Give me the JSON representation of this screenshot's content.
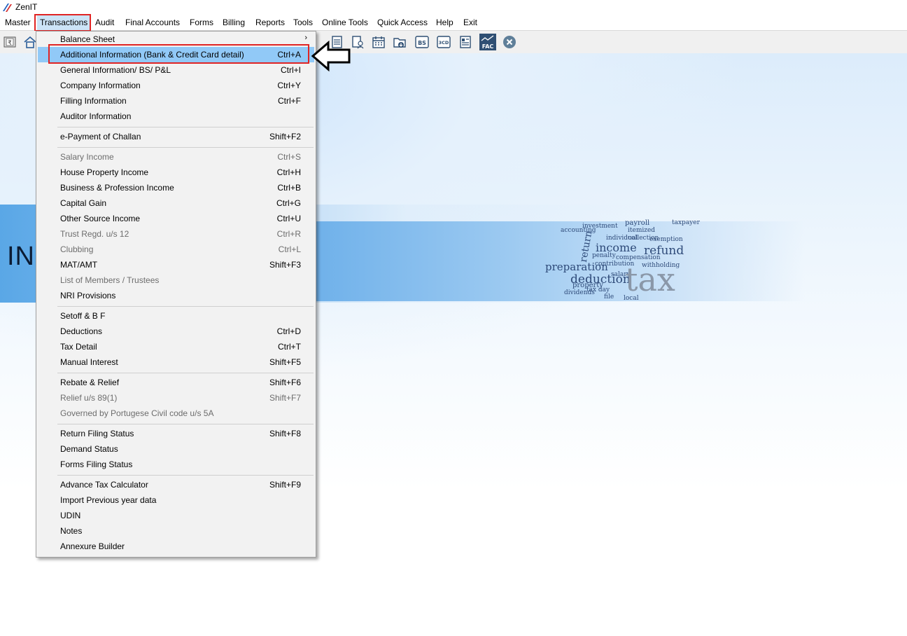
{
  "app": {
    "title": "ZenIT"
  },
  "menubar": {
    "items": [
      "Master",
      "Transactions",
      "Audit",
      "Final Accounts",
      "Forms",
      "Billing",
      "Reports",
      "Tools",
      "Online Tools",
      "Quick Access",
      "Help",
      "Exit"
    ],
    "active": "Transactions"
  },
  "toolbar": {
    "icons": [
      "rupee-book-icon",
      "home-icon",
      "document-list-icon",
      "user-document-icon",
      "calendar-icon",
      "folder-download-icon",
      "bs-icon",
      "3cd-icon",
      "form-icon",
      "fac-icon",
      "close-circle-icon"
    ],
    "labels": {
      "bs": "BS",
      "cd": "3CD",
      "fac": "FAC"
    }
  },
  "banner": {
    "text": "INC"
  },
  "word_cloud": [
    "payroll",
    "taxpayer",
    "itemized",
    "accounting",
    "investment",
    "collection",
    "return",
    "income",
    "refund",
    "deduction",
    "preparation",
    "penalty",
    "compensation",
    "contribution",
    "property",
    "salary",
    "dividends",
    "individual",
    "tax day",
    "file",
    "local",
    "exemption",
    "withholding",
    "tax"
  ],
  "dropdown": {
    "items": [
      {
        "label": "Balance Sheet",
        "shortcut": "",
        "submenu": true,
        "disabled": false
      },
      {
        "label": "Additional Information (Bank & Credit Card detail)",
        "shortcut": "Ctrl+A",
        "selected": true,
        "disabled": false
      },
      {
        "label": "General Information/ BS/ P&L",
        "shortcut": "Ctrl+I",
        "disabled": false
      },
      {
        "label": "Company Information",
        "shortcut": "Ctrl+Y",
        "disabled": false
      },
      {
        "label": "Filling Information",
        "shortcut": "Ctrl+F",
        "disabled": false
      },
      {
        "label": "Auditor Information",
        "shortcut": "",
        "disabled": false
      },
      {
        "label": "e-Payment of Challan",
        "shortcut": "Shift+F2",
        "disabled": false
      },
      {
        "label": "Salary Income",
        "shortcut": "Ctrl+S",
        "disabled": true
      },
      {
        "label": "House Property Income",
        "shortcut": "Ctrl+H",
        "disabled": false
      },
      {
        "label": "Business & Profession Income",
        "shortcut": "Ctrl+B",
        "disabled": false
      },
      {
        "label": "Capital Gain",
        "shortcut": "Ctrl+G",
        "disabled": false
      },
      {
        "label": "Other Source Income",
        "shortcut": "Ctrl+U",
        "disabled": false
      },
      {
        "label": "Trust Regd. u/s 12",
        "shortcut": "Ctrl+R",
        "disabled": true
      },
      {
        "label": "Clubbing",
        "shortcut": "Ctrl+L",
        "disabled": true
      },
      {
        "label": "MAT/AMT",
        "shortcut": "Shift+F3",
        "disabled": false
      },
      {
        "label": "List of Members / Trustees",
        "shortcut": "",
        "disabled": true
      },
      {
        "label": "NRI Provisions",
        "shortcut": "",
        "disabled": false
      },
      {
        "label": "Setoff & B F",
        "shortcut": "",
        "disabled": false
      },
      {
        "label": "Deductions",
        "shortcut": "Ctrl+D",
        "disabled": false
      },
      {
        "label": "Tax Detail",
        "shortcut": "Ctrl+T",
        "disabled": false
      },
      {
        "label": "Manual Interest",
        "shortcut": "Shift+F5",
        "disabled": false
      },
      {
        "label": "Rebate & Relief",
        "shortcut": "Shift+F6",
        "disabled": false
      },
      {
        "label": "Relief u/s 89(1)",
        "shortcut": "Shift+F7",
        "disabled": true
      },
      {
        "label": "Governed by Portugese Civil code u/s 5A",
        "shortcut": "",
        "disabled": true
      },
      {
        "label": "Return Filing Status",
        "shortcut": "Shift+F8",
        "disabled": false
      },
      {
        "label": "Demand Status",
        "shortcut": "",
        "disabled": false
      },
      {
        "label": "Forms Filing Status",
        "shortcut": "",
        "disabled": false
      },
      {
        "label": "Advance Tax Calculator",
        "shortcut": "Shift+F9",
        "disabled": false
      },
      {
        "label": "Import Previous year data",
        "shortcut": "",
        "disabled": false
      },
      {
        "label": "UDIN",
        "shortcut": "",
        "disabled": false
      },
      {
        "label": "Notes",
        "shortcut": "",
        "disabled": false
      },
      {
        "label": "Annexure Builder",
        "shortcut": "",
        "disabled": false
      }
    ]
  },
  "colors": {
    "highlight_box": "#e02424",
    "selected_row": "#91c9f7",
    "disabled_text": "#6d6d6d"
  }
}
